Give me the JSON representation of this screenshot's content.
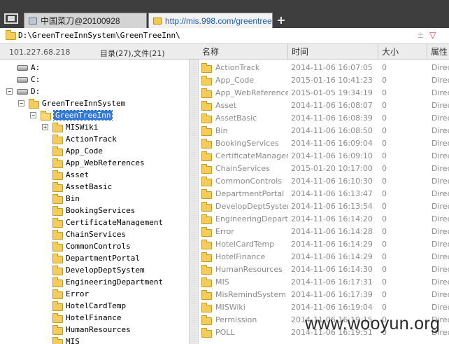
{
  "tabs": [
    {
      "label": "中国菜刀@20100928"
    },
    {
      "label": "http://mis.998.com/greentreei..."
    }
  ],
  "new_tab_label": "+",
  "address": {
    "path": "D:\\GreenTreeInnSystem\\GreenTreeInn\\",
    "pin_glyph": "±",
    "dropdown_glyph": "▽"
  },
  "header": {
    "server_ip": "101.227.68.218",
    "summary": "目录(27),文件(21)",
    "columns": {
      "name": "名称",
      "time": "时间",
      "size": "大小",
      "attr": "属性"
    }
  },
  "tree": {
    "nodes": [
      {
        "label": "A:",
        "type": "drive",
        "depth": 0,
        "expander": ""
      },
      {
        "label": "C:",
        "type": "drive",
        "depth": 0,
        "expander": ""
      },
      {
        "label": "D:",
        "type": "drive",
        "depth": 0,
        "expander": "−"
      },
      {
        "label": "GreenTreeInnSystem",
        "type": "folder",
        "depth": 1,
        "expander": "−"
      },
      {
        "label": "GreenTreeInn",
        "type": "folder",
        "depth": 2,
        "expander": "−",
        "selected": true,
        "open": true
      },
      {
        "label": "MISWiki",
        "type": "folder",
        "depth": 3,
        "expander": "+"
      },
      {
        "label": "ActionTrack",
        "type": "folder",
        "depth": 3,
        "expander": ""
      },
      {
        "label": "App_Code",
        "type": "folder",
        "depth": 3,
        "expander": ""
      },
      {
        "label": "App_WebReferences",
        "type": "folder",
        "depth": 3,
        "expander": ""
      },
      {
        "label": "Asset",
        "type": "folder",
        "depth": 3,
        "expander": ""
      },
      {
        "label": "AssetBasic",
        "type": "folder",
        "depth": 3,
        "expander": ""
      },
      {
        "label": "Bin",
        "type": "folder",
        "depth": 3,
        "expander": ""
      },
      {
        "label": "BookingServices",
        "type": "folder",
        "depth": 3,
        "expander": ""
      },
      {
        "label": "CertificateManagement",
        "type": "folder",
        "depth": 3,
        "expander": ""
      },
      {
        "label": "ChainServices",
        "type": "folder",
        "depth": 3,
        "expander": ""
      },
      {
        "label": "CommonControls",
        "type": "folder",
        "depth": 3,
        "expander": ""
      },
      {
        "label": "DepartmentPortal",
        "type": "folder",
        "depth": 3,
        "expander": ""
      },
      {
        "label": "DevelopDeptSystem",
        "type": "folder",
        "depth": 3,
        "expander": ""
      },
      {
        "label": "EngineeringDepartment",
        "type": "folder",
        "depth": 3,
        "expander": ""
      },
      {
        "label": "Error",
        "type": "folder",
        "depth": 3,
        "expander": ""
      },
      {
        "label": "HotelCardTemp",
        "type": "folder",
        "depth": 3,
        "expander": ""
      },
      {
        "label": "HotelFinance",
        "type": "folder",
        "depth": 3,
        "expander": ""
      },
      {
        "label": "HumanResources",
        "type": "folder",
        "depth": 3,
        "expander": ""
      },
      {
        "label": "MIS",
        "type": "folder",
        "depth": 3,
        "expander": ""
      }
    ]
  },
  "files": [
    {
      "name": "ActionTrack",
      "time": "2014-11-06 16:07:05",
      "size": "0",
      "attr": "Direct"
    },
    {
      "name": "App_Code",
      "time": "2015-01-16 10:41:23",
      "size": "0",
      "attr": "Direct"
    },
    {
      "name": "App_WebReferences",
      "time": "2015-01-05 19:34:19",
      "size": "0",
      "attr": "Direct"
    },
    {
      "name": "Asset",
      "time": "2014-11-06 16:08:07",
      "size": "0",
      "attr": "Direct"
    },
    {
      "name": "AssetBasic",
      "time": "2014-11-06 16:08:39",
      "size": "0",
      "attr": "Direct"
    },
    {
      "name": "Bin",
      "time": "2014-11-06 16:08:50",
      "size": "0",
      "attr": "Direct"
    },
    {
      "name": "BookingServices",
      "time": "2014-11-06 16:09:04",
      "size": "0",
      "attr": "Direct"
    },
    {
      "name": "CertificateManagem...",
      "time": "2014-11-06 16:09:10",
      "size": "0",
      "attr": "Direct"
    },
    {
      "name": "ChainServices",
      "time": "2015-01-20 10:17:00",
      "size": "0",
      "attr": "Direct"
    },
    {
      "name": "CommonControls",
      "time": "2014-11-06 16:10:30",
      "size": "0",
      "attr": "Direct"
    },
    {
      "name": "DepartmentPortal",
      "time": "2014-11-06 16:13:47",
      "size": "0",
      "attr": "Direct"
    },
    {
      "name": "DevelopDeptSystem",
      "time": "2014-11-06 16:13:54",
      "size": "0",
      "attr": "Direct"
    },
    {
      "name": "EngineeringDepart...",
      "time": "2014-11-06 16:14:20",
      "size": "0",
      "attr": "Direct"
    },
    {
      "name": "Error",
      "time": "2014-11-06 16:14:28",
      "size": "0",
      "attr": "Direct"
    },
    {
      "name": "HotelCardTemp",
      "time": "2014-11-06 16:14:29",
      "size": "0",
      "attr": "Direct"
    },
    {
      "name": "HotelFinance",
      "time": "2014-11-06 16:14:29",
      "size": "0",
      "attr": "Direct"
    },
    {
      "name": "HumanResources",
      "time": "2014-11-06 16:14:30",
      "size": "0",
      "attr": "Direct"
    },
    {
      "name": "MIS",
      "time": "2014-11-06 16:17:31",
      "size": "0",
      "attr": "Direct"
    },
    {
      "name": "MisRemindSystem",
      "time": "2014-11-06 16:17:39",
      "size": "0",
      "attr": "Direct"
    },
    {
      "name": "MISWiki",
      "time": "2014-11-06 16:19:04",
      "size": "0",
      "attr": "Direct"
    },
    {
      "name": "Permission",
      "time": "2014-11-06 16:19:15",
      "size": "0",
      "attr": "Direct"
    },
    {
      "name": "POLL",
      "time": "2014-11-06 16:19:51",
      "size": "0",
      "attr": "Direct"
    }
  ],
  "watermark": "www.wooyun.org",
  "colors": {
    "selection": "#3178d8",
    "folder": "#f3cc5c",
    "tab_url": "#1a5fb4",
    "tab_strip": "#3e3e3e"
  }
}
